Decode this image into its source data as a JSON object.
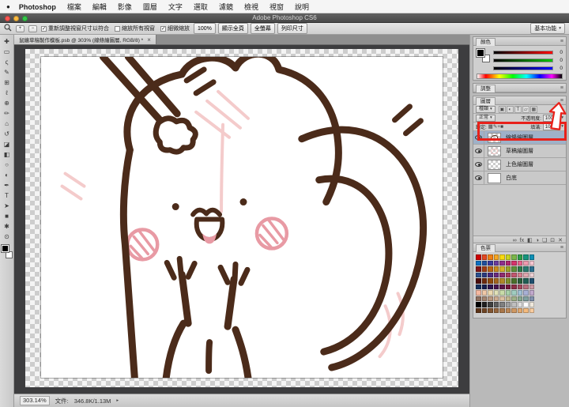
{
  "window": {
    "title": "Adobe Photoshop CS6"
  },
  "icons": {
    "apple_logo": "●",
    "caret_down": "▾",
    "caret_right": "▸",
    "menu": "≡",
    "close": "×",
    "check": "✓"
  },
  "menubar": {
    "items": [
      "Photoshop",
      "檔案",
      "編輯",
      "影像",
      "圖層",
      "文字",
      "選取",
      "濾鏡",
      "檢視",
      "視窗",
      "說明"
    ]
  },
  "options_bar": {
    "checkboxes": [
      {
        "label": "重新調整視窗尺寸以符合",
        "checked": true
      },
      {
        "label": "縮放所有視窗",
        "checked": false
      },
      {
        "label": "細微縮放",
        "checked": true
      }
    ],
    "buttons": [
      "100%",
      "顯示全頁",
      "全螢幕",
      "列印尺寸"
    ],
    "workspace": "基本功能"
  },
  "document_tab": {
    "title": "鼠繪草稿製作模板.psb @ 303% (線條繪圖層, RGB/8) *"
  },
  "toolbar": {
    "tools": [
      {
        "name": "move-tool",
        "glyph": "✚"
      },
      {
        "name": "marquee-tool",
        "glyph": "▭"
      },
      {
        "name": "lasso-tool",
        "glyph": "ς"
      },
      {
        "name": "quick-selection-tool",
        "glyph": "✎"
      },
      {
        "name": "crop-tool",
        "glyph": "⊞"
      },
      {
        "name": "eyedropper-tool",
        "glyph": "ℓ"
      },
      {
        "name": "healing-brush-tool",
        "glyph": "⊕"
      },
      {
        "name": "brush-tool",
        "glyph": "✏"
      },
      {
        "name": "clone-stamp-tool",
        "glyph": "⌂"
      },
      {
        "name": "history-brush-tool",
        "glyph": "↺"
      },
      {
        "name": "eraser-tool",
        "glyph": "◪"
      },
      {
        "name": "gradient-tool",
        "glyph": "◧"
      },
      {
        "name": "blur-tool",
        "glyph": "○"
      },
      {
        "name": "dodge-tool",
        "glyph": "◐"
      },
      {
        "name": "pen-tool",
        "glyph": "✒"
      },
      {
        "name": "type-tool",
        "glyph": "T"
      },
      {
        "name": "path-selection-tool",
        "glyph": "➤"
      },
      {
        "name": "shape-tool",
        "glyph": "■"
      },
      {
        "name": "hand-tool",
        "glyph": "✱"
      },
      {
        "name": "zoom-tool",
        "glyph": "⊙"
      }
    ]
  },
  "panels": {
    "color": {
      "tab": "顏色",
      "channels": [
        {
          "name": "r",
          "value": "0"
        },
        {
          "name": "g",
          "value": "0"
        },
        {
          "name": "b",
          "value": "0"
        }
      ]
    },
    "adjust": {
      "tab": "調整"
    },
    "layers": {
      "tab": "圖層",
      "filter_label": "種類",
      "filter_icons": [
        "▣",
        "◐",
        "T",
        "▱",
        "▦"
      ],
      "blend_mode": "正常",
      "opacity_label": "不透明度:",
      "opacity_value": "100%",
      "lock_label": "鎖定:",
      "lock_icons": [
        "▦",
        "✎",
        "+",
        "■"
      ],
      "fill_label": "填滿:",
      "fill_value": "100%",
      "rows": [
        {
          "name": "線條繪圖層",
          "thumb": "line",
          "visible": true,
          "selected": true
        },
        {
          "name": "草稿繪圖層",
          "thumb": "sketch",
          "visible": true,
          "selected": false
        },
        {
          "name": "上色繪圖層",
          "thumb": "paint",
          "visible": true,
          "selected": false
        },
        {
          "name": "白底",
          "thumb": "white",
          "visible": true,
          "selected": false
        }
      ],
      "bottom_icons": [
        {
          "name": "link-layers-icon",
          "glyph": "∞"
        },
        {
          "name": "layer-style-icon",
          "glyph": "fx"
        },
        {
          "name": "layer-mask-icon",
          "glyph": "◧"
        },
        {
          "name": "adjustment-layer-icon",
          "glyph": "◑"
        },
        {
          "name": "layer-group-icon",
          "glyph": "❏"
        },
        {
          "name": "new-layer-icon",
          "glyph": "⊡"
        },
        {
          "name": "delete-layer-icon",
          "glyph": "✕"
        }
      ]
    },
    "swatches": {
      "tab": "色票",
      "cols": 10,
      "colors": [
        "#cc0001",
        "#e4461f",
        "#f07f13",
        "#f5a623",
        "#f8d90f",
        "#c8d41f",
        "#7ab648",
        "#2e9e49",
        "#14957d",
        "#0f8fb4",
        "#0b6fc2",
        "#1f4f9e",
        "#3a3a9e",
        "#6a3a9e",
        "#8e2f8e",
        "#b02470",
        "#d6336c",
        "#e8638c",
        "#f09cb0",
        "#f5c6d0",
        "#7f1416",
        "#a03c14",
        "#b86414",
        "#c98a1e",
        "#d4b02a",
        "#9aa32a",
        "#5f8f3a",
        "#2f7a4a",
        "#2a7a6f",
        "#2a6f8f",
        "#2a4f8f",
        "#2a3a7f",
        "#4a2a7f",
        "#6a2a7f",
        "#8f2a6f",
        "#aa3a5f",
        "#c2576f",
        "#d4808f",
        "#e0a8b0",
        "#ecd0d4",
        "#4a0c0c",
        "#6f2a0c",
        "#8f4a0c",
        "#a3661f",
        "#b0882a",
        "#7f8f2a",
        "#4a6f2a",
        "#2a5f3a",
        "#1f5f55",
        "#1f4f6f",
        "#16305f",
        "#161f4f",
        "#2f164f",
        "#47164f",
        "#5f1647",
        "#76163a",
        "#8f2f47",
        "#a34a5f",
        "#b87080",
        "#cc9aa3",
        "#f5b8a0",
        "#f0c8a8",
        "#ebd8b0",
        "#e0e0b8",
        "#c8dba8",
        "#a8d0a8",
        "#a0ccc0",
        "#a0c0d4",
        "#a8b0d4",
        "#c0a8cc",
        "#8f7060",
        "#a38470",
        "#b89880",
        "#ccac90",
        "#dbc0a0",
        "#c2b890",
        "#9eb088",
        "#88a890",
        "#80a0a0",
        "#8090ac",
        "#000000",
        "#1f1f1f",
        "#3f3f3f",
        "#5f5f5f",
        "#7f7f7f",
        "#9f9f9f",
        "#bfbfbf",
        "#dfdfdf",
        "#ffffff",
        "#efe8dc",
        "#5c3317",
        "#6f4423",
        "#825530",
        "#96663d",
        "#a9774a",
        "#bc8857",
        "#cf9964",
        "#e2aa71",
        "#f5bb7e",
        "#f8cca0"
      ]
    }
  },
  "status_bar": {
    "zoom": "303.14%",
    "doc_label": "文件:",
    "doc_size": "346.8K/1.13M"
  },
  "artwork": {
    "line_color": "#4b2b1a",
    "blush_color": "#e89aa4",
    "sketch_color": "#f3c6c6",
    "canvas_color": "#ffffff"
  },
  "annotation": {
    "color": "#e8211a"
  }
}
